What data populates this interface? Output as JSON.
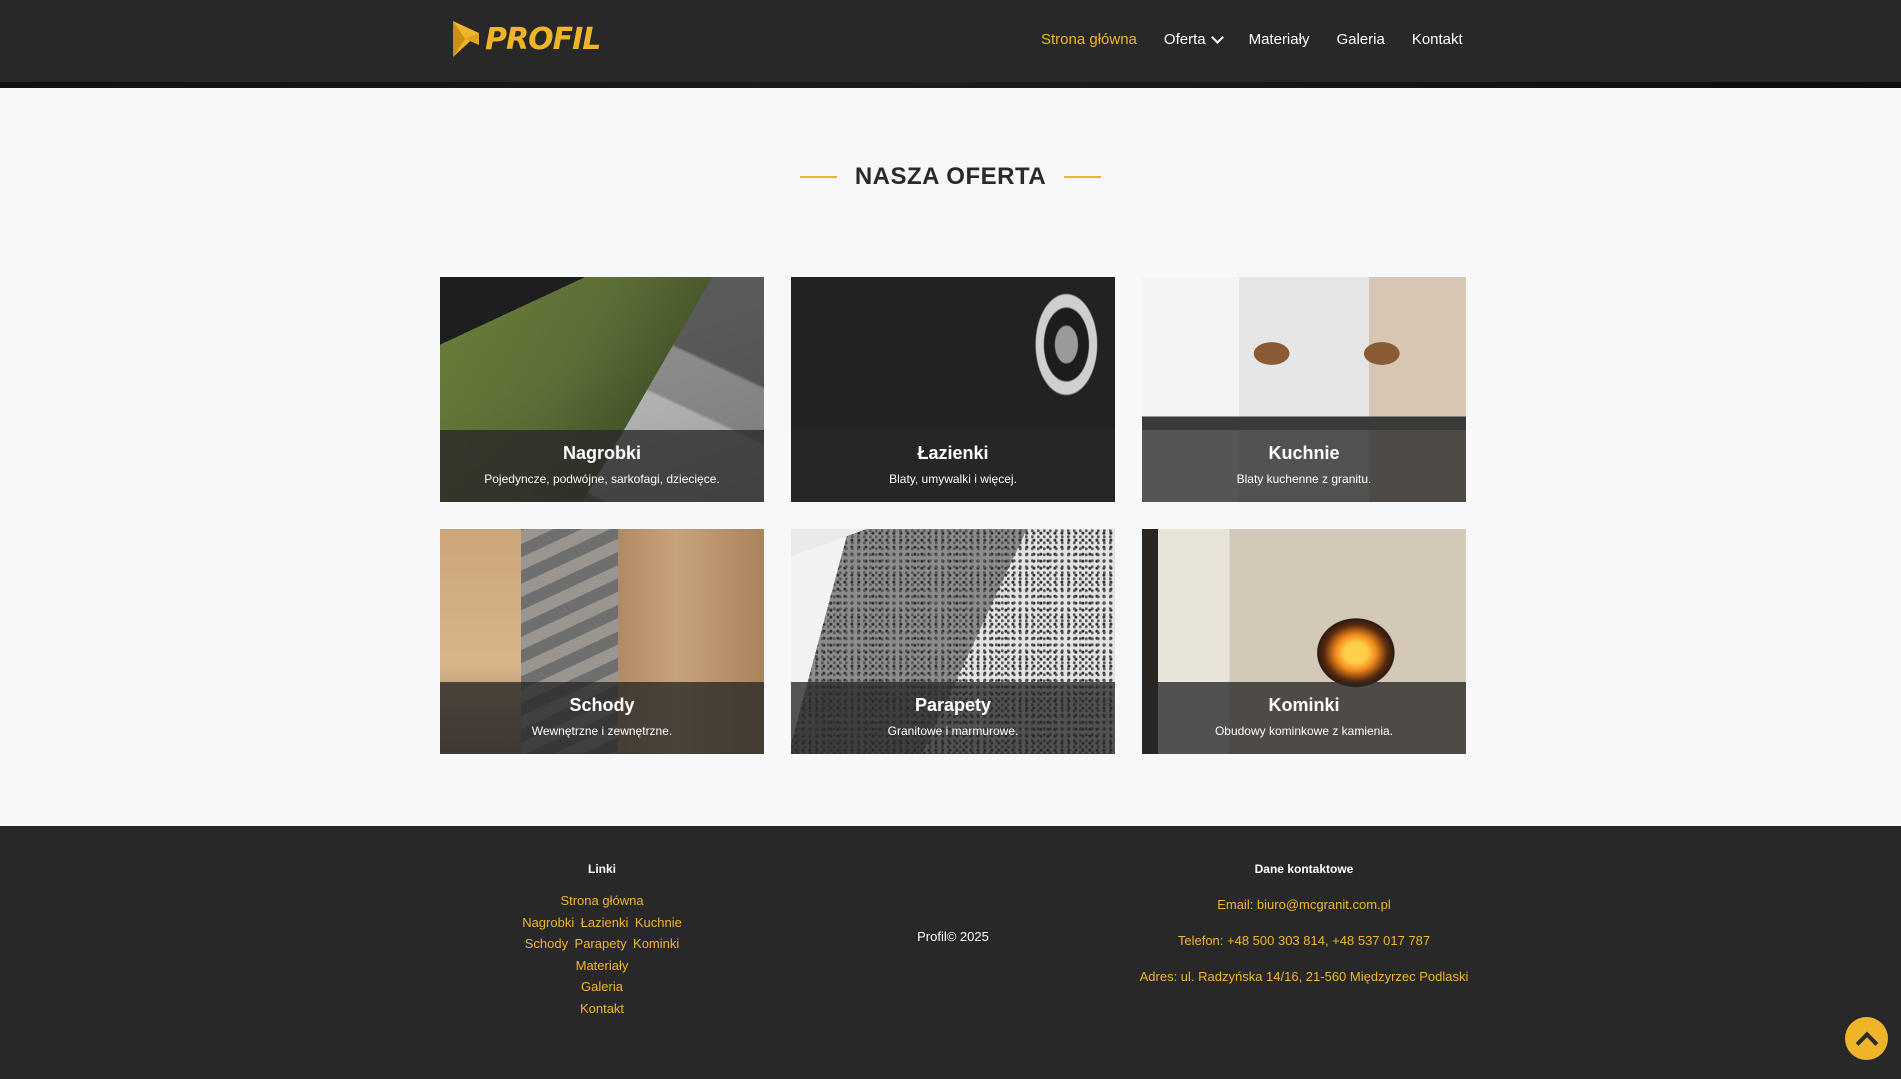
{
  "header": {
    "logo_text": "PROFIL",
    "nav": [
      {
        "label": "Strona główna",
        "active": true
      },
      {
        "label": "Oferta",
        "has_dropdown": true
      },
      {
        "label": "Materiały"
      },
      {
        "label": "Galeria"
      },
      {
        "label": "Kontakt"
      }
    ]
  },
  "section": {
    "title": "NASZA OFERTA"
  },
  "cards": [
    {
      "title": "Nagrobki",
      "description": "Pojedyncze, podwójne, sarkofagi, dziecięce."
    },
    {
      "title": "Łazienki",
      "description": "Blaty, umywalki i więcej."
    },
    {
      "title": "Kuchnie",
      "description": "Blaty kuchenne z granitu."
    },
    {
      "title": "Schody",
      "description": "Wewnętrzne i zewnętrzne."
    },
    {
      "title": "Parapety",
      "description": "Granitowe i marmurowe."
    },
    {
      "title": "Kominki",
      "description": "Obudowy kominkowe z kamienia."
    }
  ],
  "footer": {
    "links_heading": "Linki",
    "links": {
      "home": "Strona główna",
      "row1": [
        "Nagrobki",
        "Łazienki",
        "Kuchnie"
      ],
      "row2": [
        "Schody",
        "Parapety",
        "Kominki"
      ],
      "materials": "Materiały",
      "gallery": "Galeria",
      "contact": "Kontakt"
    },
    "copyright": "Profil© 2025",
    "contact_heading": "Dane kontaktowe",
    "email": "Email: biuro@mcgranit.com.pl",
    "phone": "Telefon: +48 500 303 814, +48 537 017 787",
    "address": "Adres: ul. Radzyńska 14/16, 21-560 Międzyrzec Podlaski"
  },
  "colors": {
    "accent": "#f0b429",
    "header_bg": "#282828",
    "page_bg": "#f6f8fa"
  },
  "icons": {
    "scroll_top": "chevron-up-icon",
    "logo": "profil-logo-icon",
    "dropdown": "chevron-down-icon"
  }
}
